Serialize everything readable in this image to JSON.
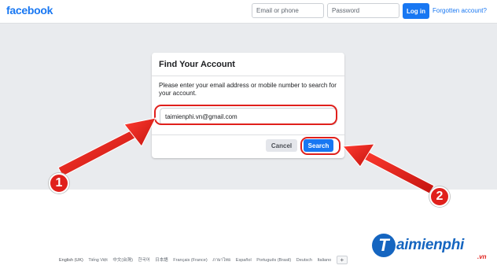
{
  "header": {
    "logo": "facebook",
    "email_placeholder": "Email or phone",
    "password_placeholder": "Password",
    "login_label": "Log in",
    "forgot_label": "Forgotten account?"
  },
  "card": {
    "title": "Find Your Account",
    "description": "Please enter your email address or mobile number to search for your account.",
    "email_value": "taimienphi.vn@gmail.com",
    "cancel_label": "Cancel",
    "search_label": "Search"
  },
  "annotations": {
    "badge1": "1",
    "badge2": "2",
    "color": "#e0201c"
  },
  "footer": {
    "languages": [
      "English (UK)",
      "Tiếng Việt",
      "中文(台灣)",
      "한국어",
      "日本語",
      "Français (France)",
      "ภาษาไทย",
      "Español",
      "Português (Brasil)",
      "Deutsch",
      "Italiano"
    ],
    "add_label": "+"
  },
  "watermark": {
    "logo_letter": "T",
    "name": "aimienphi",
    "suffix": ".vn"
  },
  "colors": {
    "brand": "#1877f2",
    "background": "#e9ebee",
    "annotation": "#e0201c",
    "watermark": "#1565c0"
  }
}
